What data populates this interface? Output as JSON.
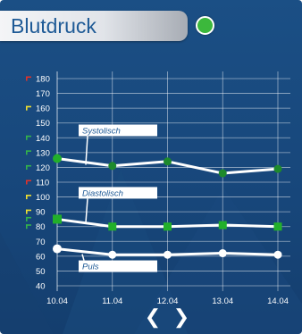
{
  "header": {
    "title": "Blutdruck",
    "status_color": "#3cb83c"
  },
  "navigation": {
    "prev_icon": "chevron-left-icon",
    "prev_glyph": "❮",
    "next_icon": "chevron-right-icon",
    "next_glyph": "❯"
  },
  "chart_data": {
    "type": "line",
    "categories": [
      "10.04",
      "11.04",
      "12.04",
      "13.04",
      "14.04"
    ],
    "ylim": [
      40,
      180
    ],
    "yticks": [
      40,
      50,
      60,
      70,
      80,
      90,
      100,
      110,
      120,
      130,
      140,
      150,
      160,
      170,
      180
    ],
    "grid": true,
    "series": [
      {
        "name": "Systolisch",
        "values": [
          126,
          121,
          124,
          116,
          119
        ],
        "marker": "circle",
        "first_marker_color": "#22b02a",
        "marker_color": "#1e8a2c"
      },
      {
        "name": "Diastolisch",
        "values": [
          85,
          80,
          80,
          81,
          80
        ],
        "marker": "square",
        "first_marker_color": "#22b02a",
        "marker_color": "#22b02a"
      },
      {
        "name": "Puls",
        "values": [
          65,
          61,
          61,
          62,
          61
        ],
        "marker": "circle",
        "first_marker_color": "#ffffff",
        "marker_color": "#ffffff"
      }
    ],
    "zone_markers": [
      {
        "value": 180,
        "color": "#e0322a"
      },
      {
        "value": 160,
        "color": "#f0e030"
      },
      {
        "value": 140,
        "color": "#34b34a"
      },
      {
        "value": 130,
        "color": "#34b34a"
      },
      {
        "value": 120,
        "color": "#34b34a"
      },
      {
        "value": 110,
        "color": "#e0322a"
      },
      {
        "value": 100,
        "color": "#f0e030"
      },
      {
        "value": 90,
        "color": "#f0e030"
      },
      {
        "value": 85,
        "color": "#34b34a"
      },
      {
        "value": 80,
        "color": "#34b34a"
      }
    ]
  }
}
